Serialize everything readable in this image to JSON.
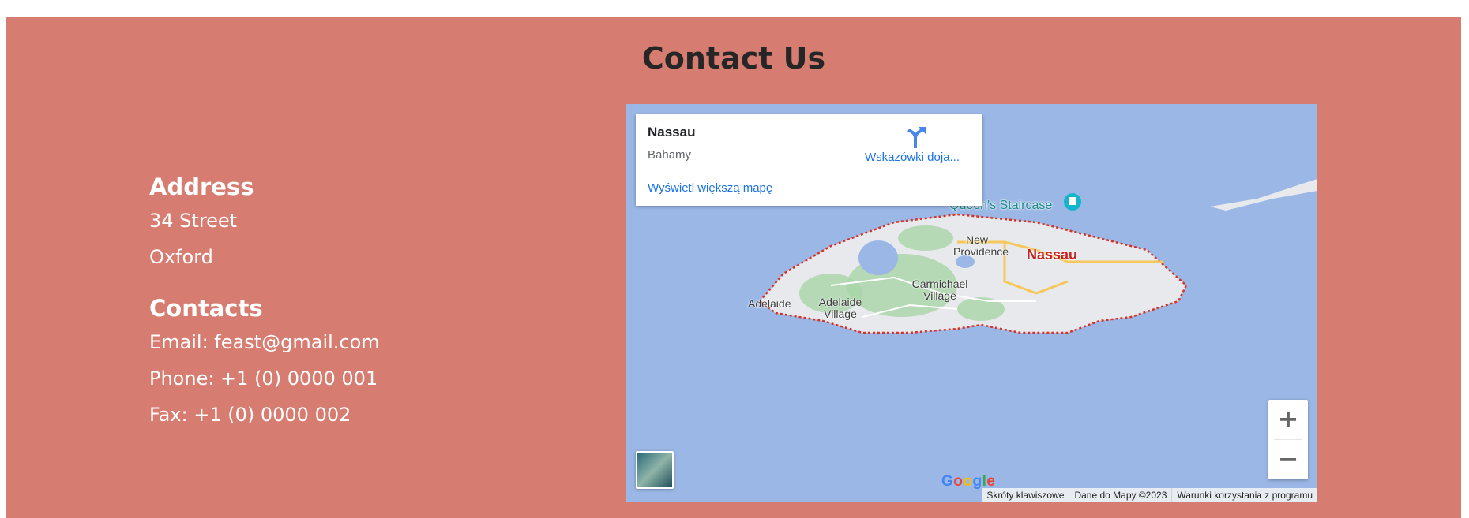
{
  "section": {
    "title": "Contact Us",
    "background": "#d67c71"
  },
  "address": {
    "heading": "Address",
    "line1": "34 Street",
    "line2": "Oxford"
  },
  "contacts": {
    "heading": "Contacts",
    "email": "Email: feast@gmail.com",
    "phone": "Phone: +1 (0) 0000 001",
    "fax": "Fax: +1 (0) 0000 002"
  },
  "map": {
    "card": {
      "place": "Nassau",
      "country": "Bahamy",
      "directions_label": "Wskazówki doja...",
      "bigger_map_link": "Wyświetl większą mapę",
      "directions_icon": "directions-icon"
    },
    "labels": {
      "poi": "Queen's Staircase",
      "city": "Nassau",
      "new_providence_1": "New",
      "new_providence_2": "Providence",
      "carmichael_1": "Carmichael",
      "carmichael_2": "Village",
      "adelaide": "Adelaide",
      "adelaide_village_1": "Adelaide",
      "adelaide_village_2": "Village"
    },
    "zoom_in": "+",
    "zoom_out": "−",
    "logo": "Google",
    "attribution": {
      "shortcuts": "Skróty klawiszowe",
      "data": "Dane do Mapy ©2023",
      "terms": "Warunki korzystania z programu"
    },
    "colors": {
      "water": "#9ab7e5",
      "land": "#e8e9ec",
      "park": "#a8d5a8",
      "boundary": "#d93025",
      "road": "#f6c75a"
    }
  }
}
